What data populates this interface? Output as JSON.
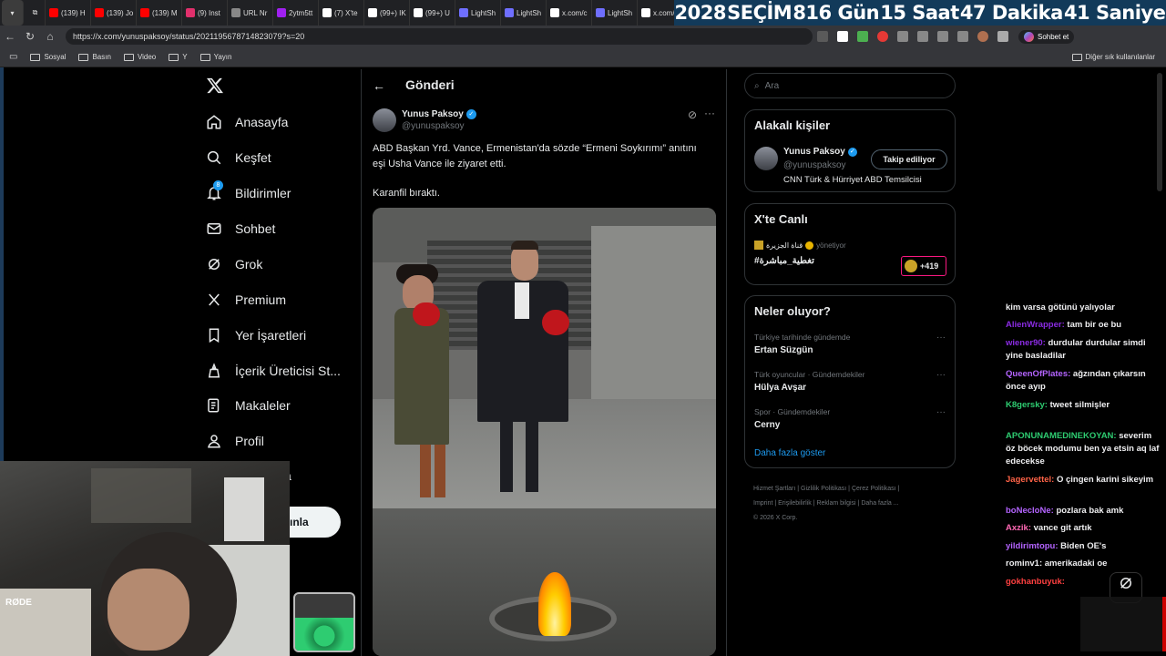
{
  "browser": {
    "tabs": [
      {
        "label": "(139) H",
        "color": "#ff0000"
      },
      {
        "label": "(139) Jo",
        "color": "#ff0000"
      },
      {
        "label": "(139) M",
        "color": "#ff0000"
      },
      {
        "label": "(9) Inst",
        "color": "#e1306c"
      },
      {
        "label": "URL Nr",
        "color": "#888888"
      },
      {
        "label": "2ytm5tt",
        "color": "#a020f0"
      },
      {
        "label": "(7) X'te",
        "color": "#ffffff"
      },
      {
        "label": "(99+) IK",
        "color": "#ffffff"
      },
      {
        "label": "(99+) U",
        "color": "#ffffff"
      },
      {
        "label": "LightSh",
        "color": "#6f6fff"
      },
      {
        "label": "LightSh",
        "color": "#6f6fff"
      },
      {
        "label": "x.com/c",
        "color": "#ffffff"
      },
      {
        "label": "LightSh",
        "color": "#6f6fff"
      },
      {
        "label": "x.com/c",
        "color": "#ffffff"
      }
    ],
    "countdown": [
      "2028",
      "SEÇİM",
      "816 Gün",
      "15 Saat",
      "47 Dakika",
      "41 Saniye"
    ],
    "url": "https://x.com/yunuspaksoy/status/2021195678714823079?s=20",
    "chat_button": "Sohbet et",
    "bookmarks": [
      "Sosyal",
      "Basın",
      "Video",
      "Y",
      "Yayın"
    ],
    "other_bookmarks": "Diğer sık kullanılanlar"
  },
  "nav": {
    "items": [
      {
        "label": "Anasayfa",
        "icon": "home-icon"
      },
      {
        "label": "Keşfet",
        "icon": "search-icon"
      },
      {
        "label": "Bildirimler",
        "icon": "bell-icon",
        "badge": "8"
      },
      {
        "label": "Sohbet",
        "icon": "mail-icon"
      },
      {
        "label": "Grok",
        "icon": "grok-icon"
      },
      {
        "label": "Premium",
        "icon": "x-icon"
      },
      {
        "label": "Yer İşaretleri",
        "icon": "bookmark-icon"
      },
      {
        "label": "İçerik Üreticisi St...",
        "icon": "studio-icon"
      },
      {
        "label": "Makaleler",
        "icon": "article-icon"
      },
      {
        "label": "Profil",
        "icon": "profile-icon"
      }
    ],
    "more_partial": "a",
    "post_button_partial": "ınla"
  },
  "post": {
    "header": "Gönderi",
    "author_name": "Yunus Paksoy",
    "author_handle": "@yunuspaksoy",
    "text_line1": "ABD Başkan Yrd. Vance, Ermenistan'da sözde “Ermeni Soykırımı” anıtını",
    "text_line2": "eşi Usha Vance ile ziyaret etti.",
    "text_line3": "Karanfil bıraktı."
  },
  "sidebar": {
    "search_placeholder": "Ara",
    "relevant_title": "Alakalı kişiler",
    "relevant_name": "Yunus Paksoy",
    "relevant_handle": "@yunuspaksoy",
    "relevant_bio": "CNN Türk & Hürriyet ABD Temsilcisi",
    "follow_label": "Takip ediliyor",
    "live_title": "X'te Canlı",
    "live_account": "قناة الجزيرة",
    "live_status": "yönetiyor",
    "live_hashtag": "#تغطية_مباشرة",
    "live_count": "+419",
    "trends_title": "Neler oluyor?",
    "trends": [
      {
        "context": "Türkiye tarihinde gündemde",
        "name": "Ertan Süzgün"
      },
      {
        "context": "Türk oyuncular · Gündemdekiler",
        "name": "Hülya Avşar"
      },
      {
        "context": "Spor · Gündemdekiler",
        "name": "Cerny"
      }
    ],
    "show_more": "Daha fazla göster",
    "footer_links": [
      "Hizmet Şartları",
      "Gizlilik Politikası",
      "Çerez Politikası",
      "Imprint",
      "Erişilebilirlik",
      "Reklam bilgisi",
      "Daha fazla ..."
    ],
    "copyright": "© 2026 X Corp."
  },
  "chat": {
    "messages": [
      {
        "user": "",
        "text": "kim varsa götünü yalıyolar",
        "color": "#efeff1"
      },
      {
        "user": "AlienWrapper:",
        "text": "tam bir oe bu",
        "color": "#8a2be2"
      },
      {
        "user": "wiener90:",
        "text": "durdular durdular simdi yine basladilar",
        "color": "#8a2be2"
      },
      {
        "user": "QueenOfPlates:",
        "text": "ağzından çıkarsın önce ayıp",
        "color": "#b464ff"
      },
      {
        "user": "K8gersky:",
        "text": "tweet silmişler",
        "color": "#2ecc71"
      },
      {
        "user": "APONUNAMEDINEKOYAN:",
        "text": "severim öz böcek modumu ben ya etsin aq laf edecekse",
        "color": "#2ecc71"
      },
      {
        "user": "Jagervettel:",
        "text": "O çingen karini sikeyim",
        "color": "#ff6347"
      },
      {
        "user": "boNecloNe:",
        "text": "pozlara bak amk",
        "color": "#b464ff"
      },
      {
        "user": "Axzik:",
        "text": "vance git artık",
        "color": "#ff69b4"
      },
      {
        "user": "yildirimtopu:",
        "text": "Biden OE's",
        "color": "#b464ff"
      },
      {
        "user": "rominv1:",
        "text": "amerikadaki oe",
        "color": "#efeff1"
      },
      {
        "user": "gokhanbuyuk:",
        "text": "",
        "color": "#ff4040"
      }
    ]
  },
  "colors": {
    "accent": "#1d9bf0",
    "bg": "#000000",
    "border": "#2f3336",
    "muted": "#71767b"
  }
}
